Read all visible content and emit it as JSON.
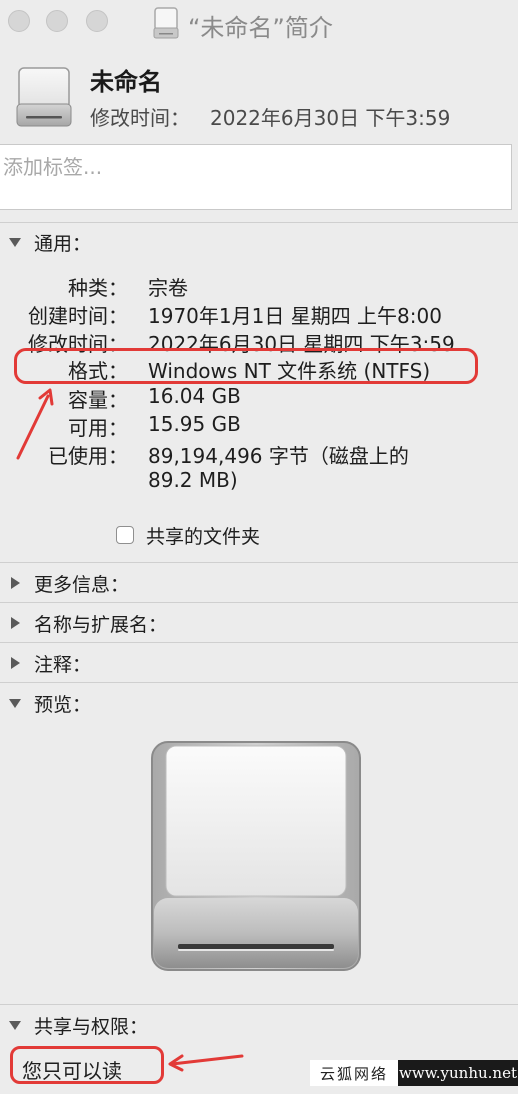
{
  "window": {
    "title": "“未命名”简介"
  },
  "header": {
    "name": "未命名",
    "modified_label": "修改时间：",
    "modified_value": "2022年6月30日 下午3:59"
  },
  "tags": {
    "placeholder": "添加标签..."
  },
  "sections": {
    "general": "通用：",
    "more_info": "更多信息：",
    "name_ext": "名称与扩展名：",
    "comments": "注释：",
    "preview": "预览：",
    "sharing": "共享与权限："
  },
  "general": {
    "rows": [
      {
        "label": "种类：",
        "value": "宗卷"
      },
      {
        "label": "创建时间：",
        "value": "1970年1月1日 星期四 上午8:00"
      },
      {
        "label": "修改时间：",
        "value": "2022年6月30日 星期四 下午3:59"
      },
      {
        "label": "格式：",
        "value": "Windows NT 文件系统 (NTFS)"
      },
      {
        "label": "容量：",
        "value": "16.04 GB"
      },
      {
        "label": "可用：",
        "value": "15.95 GB"
      },
      {
        "label": "已使用：",
        "value": "89,194,496 字节（磁盘上的"
      }
    ],
    "used_line2": "89.2 MB)",
    "shared_folder_label": "共享的文件夹"
  },
  "permissions": {
    "status": "您只可以读"
  },
  "watermark": {
    "cn": "云狐网络",
    "url": "www.yunhu.net"
  },
  "colors": {
    "annotation_red": "#e23a37"
  }
}
